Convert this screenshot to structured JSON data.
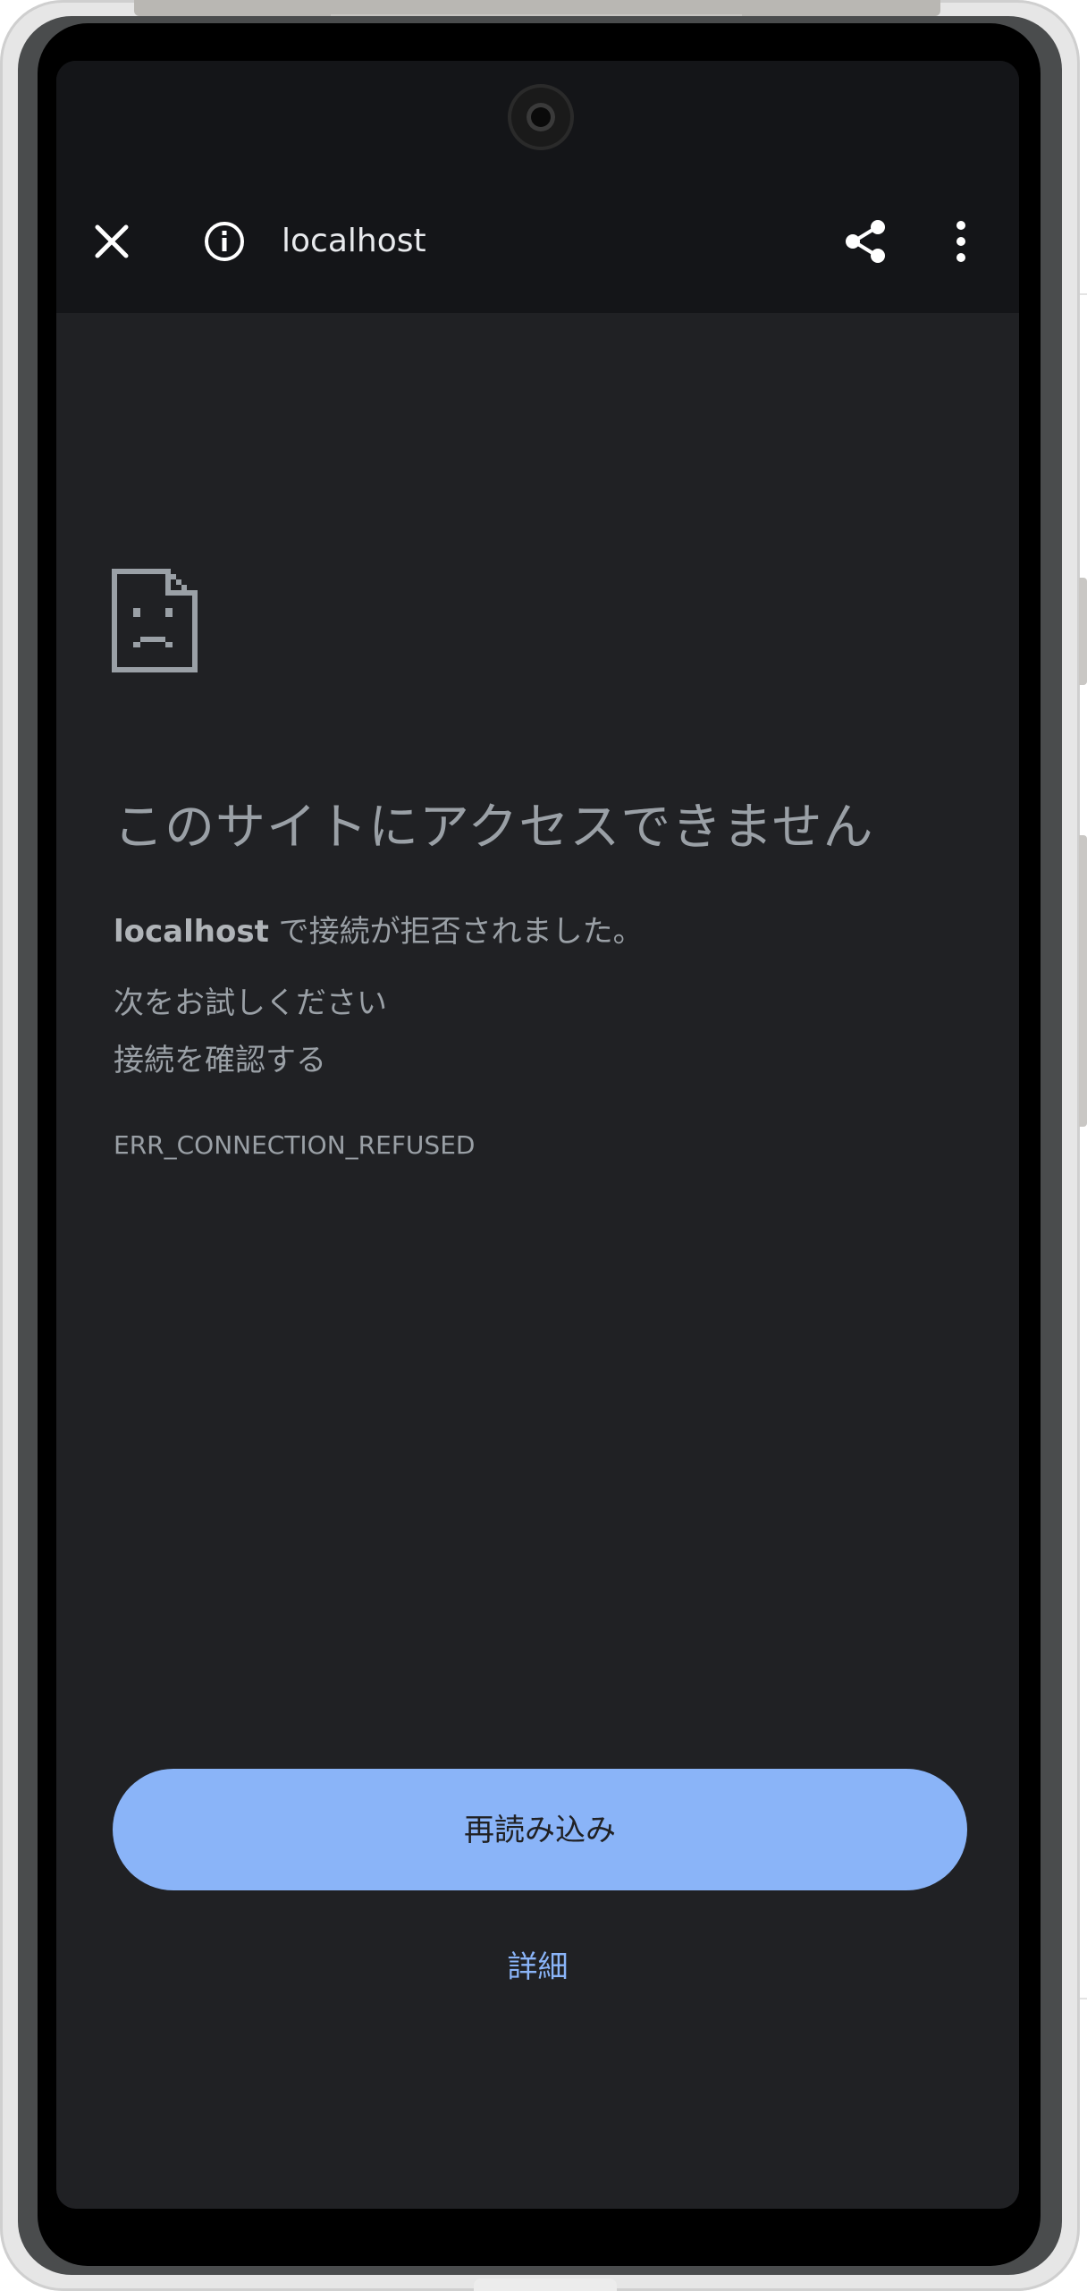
{
  "toolbar": {
    "url": "localhost",
    "icons": [
      "close-icon",
      "info-icon",
      "share-icon",
      "more-vert-icon"
    ]
  },
  "error": {
    "icon": "sad-document-icon",
    "title": "このサイトにアクセスできません",
    "host": "localhost",
    "description": " で接続が拒否されました。",
    "suggest_heading": "次をお試しください",
    "suggest_item": "接続を確認する",
    "code": "ERR_CONNECTION_REFUSED"
  },
  "actions": {
    "reload_label": "再読み込み",
    "details_label": "詳細"
  },
  "colors": {
    "toolbar_bg": "#141518",
    "page_bg": "#202124",
    "text_secondary": "#9aa0a6",
    "accent": "#8ab4f8"
  }
}
